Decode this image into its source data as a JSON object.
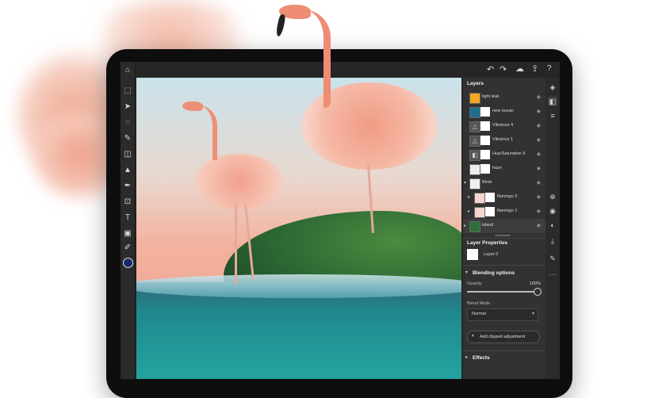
{
  "toolbar": {
    "tools": [
      "home-icon",
      "select-icon",
      "move-icon",
      "lasso-icon",
      "brush-icon",
      "eraser-icon",
      "fill-icon",
      "clone-icon",
      "crop-icon",
      "type-icon",
      "image-icon",
      "eyedropper-icon",
      "color-swatch"
    ],
    "glyphs": [
      "⌂",
      "⬚",
      "➤",
      "◌",
      "✎",
      "◫",
      "▲",
      "✒",
      "⊡",
      "T",
      "▣",
      "✐",
      "●"
    ]
  },
  "topbar": {
    "undo": "↶",
    "redo": "↷",
    "cloud": "☁",
    "share": "⇪",
    "help": "?"
  },
  "layers_panel": {
    "title": "Layers",
    "layers": [
      {
        "name": "light leak",
        "thumb": "#f5a623",
        "indent": false,
        "group": false
      },
      {
        "name": "new ocean",
        "thumb": "#1f6f8b",
        "indent": false,
        "group": false
      },
      {
        "name": "Vibrance 4",
        "thumb": "#555555",
        "indent": false,
        "group": false
      },
      {
        "name": "Vibrance 1",
        "thumb": "#555555",
        "indent": false,
        "group": false
      },
      {
        "name": "Hue/Saturation 4",
        "thumb": "#555555",
        "indent": false,
        "group": false
      },
      {
        "name": "haze",
        "thumb": "#eeeeee",
        "indent": false,
        "group": false
      },
      {
        "name": "Birds",
        "thumb": "#f0f0f0",
        "indent": false,
        "group": true
      },
      {
        "name": "flamingo 2",
        "thumb": "#f6d5cd",
        "indent": true,
        "group": false
      },
      {
        "name": "flamingo 1",
        "thumb": "#f6d5cd",
        "indent": true,
        "group": false
      },
      {
        "name": "island",
        "thumb": "#2f6f3a",
        "indent": false,
        "group": false
      }
    ]
  },
  "layer_properties": {
    "title": "Layer Properties",
    "layer_name": "Layer 0",
    "blending_title": "Blending options",
    "opacity_label": "Opacity",
    "opacity_value": "100%",
    "blend_mode_label": "Blend Mode",
    "blend_mode_value": "Normal",
    "add_clipped_label": "Add clipped adjustment",
    "effects_label": "Effects"
  },
  "right_strip": {
    "icons": [
      "layers-icon",
      "adjust-icon",
      "properties-icon",
      "add-layer-icon",
      "visibility-icon",
      "mask-icon",
      "merge-icon",
      "paint-icon",
      "more-icon"
    ],
    "glyphs": [
      "◈",
      "◧",
      "≡",
      "⊕",
      "◉",
      "◐",
      "⤓",
      "✎",
      "···"
    ]
  },
  "colors": {
    "app_bg": "#262626",
    "panel_bg": "#323232",
    "accent": "#2d7ff9",
    "sky_top": "#cfe3ea",
    "sky_bottom": "#f2b8a6",
    "ocean": "#1f8a8f",
    "island": "#2e6b35",
    "flamingo": "#f19b84"
  }
}
